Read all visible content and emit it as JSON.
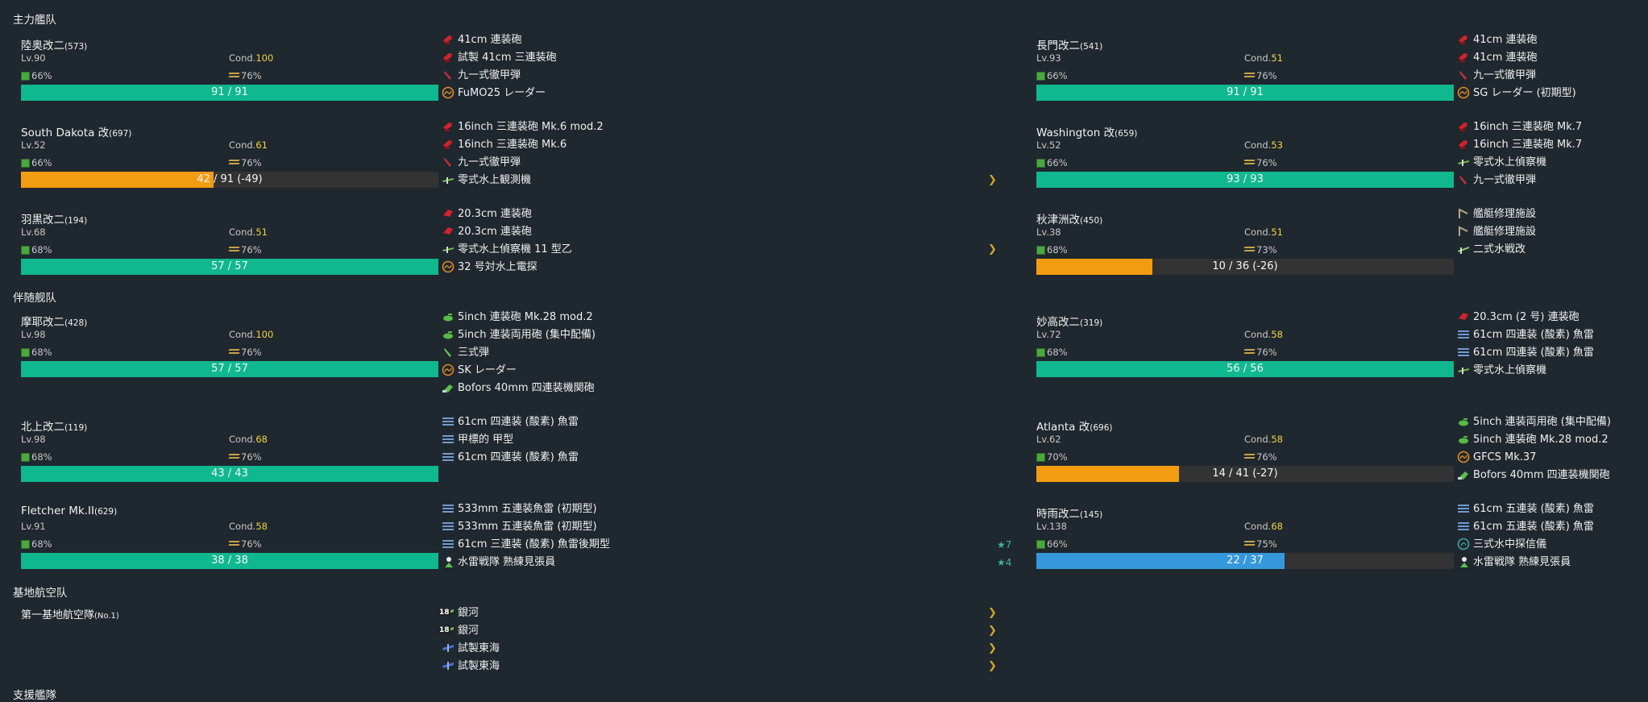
{
  "sections": {
    "main_fleet": "主力艦队",
    "escort_fleet": "伴随舰队",
    "lbas": "基地航空队",
    "support": "支援艦隊"
  },
  "ships": [
    {
      "name": "陸奥改二",
      "id": "(573)",
      "lv": "Lv.90",
      "cond_label": "Cond.",
      "cond": "100",
      "fuel": "66%",
      "ammo": "76%",
      "hp": "91 / 91",
      "hp_pct": 1.0,
      "color": "#10b88f",
      "equips": [
        {
          "icon": "main-gun-red-icon",
          "name": "41cm 連装砲"
        },
        {
          "icon": "main-gun-red-icon",
          "name": "試製 41cm 三連装砲"
        },
        {
          "icon": "ap-shell-icon",
          "name": "九一式徹甲弾"
        },
        {
          "icon": "radar-icon",
          "name": "FuMO25 レーダー"
        }
      ]
    },
    {
      "name": "長門改二",
      "id": "(541)",
      "lv": "Lv.93",
      "cond_label": "Cond.",
      "cond": "51",
      "fuel": "66%",
      "ammo": "76%",
      "hp": "91 / 91",
      "hp_pct": 1.0,
      "color": "#10b88f",
      "equips": [
        {
          "icon": "main-gun-red-icon",
          "name": "41cm 連装砲"
        },
        {
          "icon": "main-gun-red-icon",
          "name": "41cm 連装砲"
        },
        {
          "icon": "ap-shell-icon",
          "name": "九一式徹甲弾"
        },
        {
          "icon": "radar-icon",
          "name": "SG レーダー (初期型)"
        }
      ]
    },
    {
      "name": "South Dakota 改",
      "id": "(697)",
      "lv": "Lv.52",
      "cond_label": "Cond.",
      "cond": "61",
      "fuel": "66%",
      "ammo": "76%",
      "hp": "42 / 91 (-49)",
      "hp_pct": 0.462,
      "color": "#f39c12",
      "equips": [
        {
          "icon": "main-gun-red-icon",
          "name": "16inch 三連装砲 Mk.6 mod.2"
        },
        {
          "icon": "main-gun-red-icon",
          "name": "16inch 三連装砲 Mk.6"
        },
        {
          "icon": "ap-shell-icon",
          "name": "九一式徹甲弾"
        },
        {
          "icon": "seaplane-icon",
          "name": "零式水上観測機"
        }
      ]
    },
    {
      "name": "Washington 改",
      "id": "(659)",
      "lv": "Lv.52",
      "cond_label": "Cond.",
      "cond": "53",
      "fuel": "66%",
      "ammo": "76%",
      "hp": "93 / 93",
      "hp_pct": 1.0,
      "color": "#10b88f",
      "equips": [
        {
          "icon": "main-gun-red-icon",
          "name": "16inch 三連装砲 Mk.7"
        },
        {
          "icon": "main-gun-red-icon",
          "name": "16inch 三連装砲 Mk.7"
        },
        {
          "icon": "seaplane-icon",
          "name": "零式水上偵察機"
        },
        {
          "icon": "ap-shell-icon",
          "name": "九一式徹甲弾"
        }
      ]
    },
    {
      "name": "羽黒改二",
      "id": "(194)",
      "lv": "Lv.68",
      "cond_label": "Cond.",
      "cond": "51",
      "fuel": "68%",
      "ammo": "76%",
      "hp": "57 / 57",
      "hp_pct": 1.0,
      "color": "#10b88f",
      "equips": [
        {
          "icon": "medium-gun-red-icon",
          "name": "20.3cm 連装砲"
        },
        {
          "icon": "medium-gun-red-icon",
          "name": "20.3cm 連装砲"
        },
        {
          "icon": "seaplane-icon",
          "name": "零式水上偵察機 11 型乙"
        },
        {
          "icon": "radar-icon",
          "name": "32 号対水上電探"
        }
      ]
    },
    {
      "name": "秋津洲改",
      "id": "(450)",
      "lv": "Lv.38",
      "cond_label": "Cond.",
      "cond": "51",
      "fuel": "68%",
      "ammo": "73%",
      "hp": "10 / 36 (-26)",
      "hp_pct": 0.278,
      "color": "#f39c12",
      "equips": [
        {
          "icon": "repair-crane-icon",
          "name": "艦艇修理施設"
        },
        {
          "icon": "repair-crane-icon",
          "name": "艦艇修理施設"
        },
        {
          "icon": "seaplane-fighter-icon",
          "name": "二式水戦改"
        }
      ]
    },
    {
      "name": "摩耶改二",
      "id": "(428)",
      "lv": "Lv.98",
      "cond_label": "Cond.",
      "cond": "100",
      "fuel": "68%",
      "ammo": "76%",
      "hp": "57 / 57",
      "hp_pct": 1.0,
      "color": "#10b88f",
      "equips": [
        {
          "icon": "secondary-gun-green-icon",
          "name": "5inch 連装砲 Mk.28 mod.2"
        },
        {
          "icon": "secondary-gun-green-icon",
          "name": "5inch 連装両用砲 (集中配備)"
        },
        {
          "icon": "type3-shell-icon",
          "name": "三式弾"
        },
        {
          "icon": "radar-icon",
          "name": "SK レーダー"
        },
        {
          "icon": "aa-gun-icon",
          "name": "Bofors 40mm 四連装機関砲"
        }
      ]
    },
    {
      "name": "妙高改二",
      "id": "(319)",
      "lv": "Lv.72",
      "cond_label": "Cond.",
      "cond": "58",
      "fuel": "68%",
      "ammo": "76%",
      "hp": "56 / 56",
      "hp_pct": 1.0,
      "color": "#10b88f",
      "equips": [
        {
          "icon": "medium-gun-red-icon",
          "name": "20.3cm (2 号) 連装砲"
        },
        {
          "icon": "torpedo-icon",
          "name": "61cm 四連装 (酸素) 魚雷"
        },
        {
          "icon": "torpedo-icon",
          "name": "61cm 四連装 (酸素) 魚雷"
        },
        {
          "icon": "seaplane-icon",
          "name": "零式水上偵察機"
        }
      ]
    },
    {
      "name": "北上改二",
      "id": "(119)",
      "lv": "Lv.98",
      "cond_label": "Cond.",
      "cond": "68",
      "fuel": "68%",
      "ammo": "76%",
      "hp": "43 / 43",
      "hp_pct": 1.0,
      "color": "#10b88f",
      "equips": [
        {
          "icon": "torpedo-icon",
          "name": "61cm 四連装 (酸素) 魚雷"
        },
        {
          "icon": "torpedo-icon",
          "name": "甲標的 甲型"
        },
        {
          "icon": "torpedo-icon",
          "name": "61cm 四連装 (酸素) 魚雷"
        }
      ]
    },
    {
      "name": "Atlanta 改",
      "id": "(696)",
      "lv": "Lv.62",
      "cond_label": "Cond.",
      "cond": "58",
      "fuel": "70%",
      "ammo": "76%",
      "hp": "14 / 41 (-27)",
      "hp_pct": 0.341,
      "color": "#f39c12",
      "equips": [
        {
          "icon": "secondary-gun-green-icon",
          "name": "5inch 連装両用砲 (集中配備)"
        },
        {
          "icon": "secondary-gun-green-icon",
          "name": "5inch 連装砲 Mk.28 mod.2"
        },
        {
          "icon": "radar-icon",
          "name": "GFCS Mk.37"
        },
        {
          "icon": "aa-gun-icon",
          "name": "Bofors 40mm 四連装機関砲"
        }
      ]
    },
    {
      "name": "Fletcher Mk.II",
      "id": "(629)",
      "lv": "Lv.91",
      "cond_label": "Cond.",
      "cond": "58",
      "fuel": "68%",
      "ammo": "76%",
      "hp": "38 / 38",
      "hp_pct": 1.0,
      "color": "#10b88f",
      "equips": [
        {
          "icon": "torpedo-icon",
          "name": "533mm 五連装魚雷 (初期型)"
        },
        {
          "icon": "torpedo-icon",
          "name": "533mm 五連装魚雷 (初期型)"
        },
        {
          "icon": "torpedo-icon",
          "name": "61cm 三連装 (酸素) 魚雷後期型"
        },
        {
          "icon": "lookout-icon",
          "name": "水雷戦隊 熟練見張員"
        }
      ]
    },
    {
      "name": "時雨改二",
      "id": "(145)",
      "lv": "Lv.138",
      "cond_label": "Cond.",
      "cond": "68",
      "fuel": "66%",
      "ammo": "75%",
      "hp": "22 / 37",
      "hp_pct": 0.595,
      "color": "#3498db",
      "equips": [
        {
          "icon": "torpedo-icon",
          "name": "61cm 五連装 (酸素) 魚雷"
        },
        {
          "icon": "torpedo-icon",
          "name": "61cm 五連装 (酸素) 魚雷"
        },
        {
          "icon": "sonar-icon",
          "name": "三式水中探信儀"
        },
        {
          "icon": "lookout-icon",
          "name": "水雷戦隊 熟練見張員"
        }
      ]
    }
  ],
  "markers": {
    "chevron": "❯",
    "star7": "★7",
    "star4": "★4"
  },
  "lbas": {
    "name": "第一基地航空隊",
    "id": "(No.1)",
    "equips": [
      {
        "icon": "land-bomber-icon",
        "name": "銀河",
        "count": "18"
      },
      {
        "icon": "land-bomber-icon",
        "name": "銀河",
        "count": "18"
      },
      {
        "icon": "land-attacker-icon",
        "name": "試製東海"
      },
      {
        "icon": "land-attacker-icon",
        "name": "試製東海"
      }
    ]
  }
}
